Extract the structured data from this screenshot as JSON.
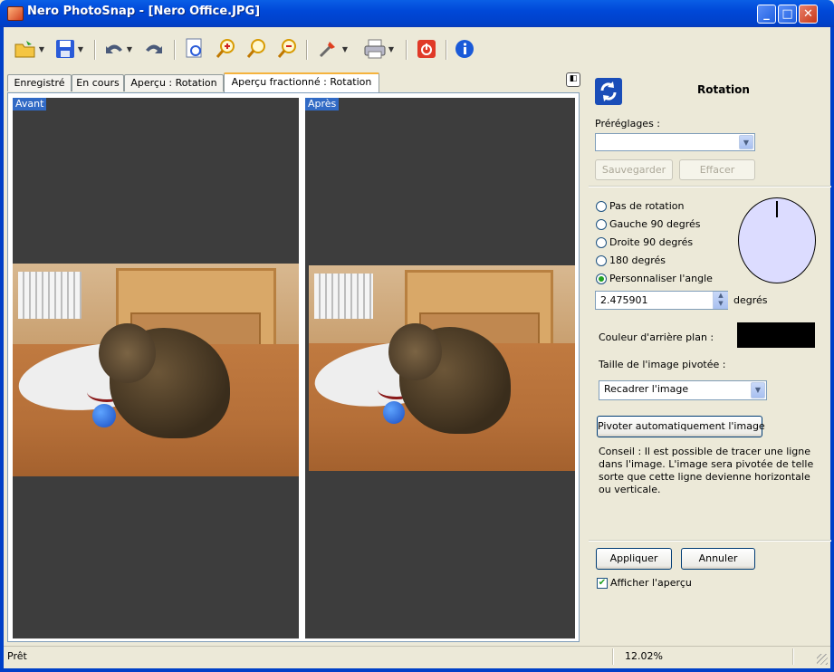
{
  "window": {
    "title": "Nero PhotoSnap - [Nero Office.JPG]",
    "minimize_glyph": "_",
    "maximize_glyph": "□",
    "close_glyph": "✕"
  },
  "toolbar": {
    "icons": [
      "open-folder-icon",
      "save-icon",
      "undo-icon",
      "redo-icon",
      "page-preview-icon",
      "zoom-in-icon",
      "zoom-fit-icon",
      "zoom-out-icon",
      "tools-icon",
      "print-icon",
      "power-icon",
      "info-icon"
    ]
  },
  "tabs": [
    {
      "label": "Enregistré",
      "active": false
    },
    {
      "label": "En cours",
      "active": false
    },
    {
      "label": "Aperçu : Rotation",
      "active": false
    },
    {
      "label": "Aperçu fractionné : Rotation",
      "active": true
    }
  ],
  "preview": {
    "before_label": "Avant",
    "after_label": "Après"
  },
  "panel": {
    "title": "Rotation",
    "presets_label": "Préréglages :",
    "presets_value": "",
    "save_label": "Sauvegarder",
    "clear_label": "Effacer",
    "rotation_options": [
      {
        "label": "Pas de rotation",
        "selected": false
      },
      {
        "label": "Gauche 90 degrés",
        "selected": false
      },
      {
        "label": "Droite 90 degrés",
        "selected": false
      },
      {
        "label": "180 degrés",
        "selected": false
      },
      {
        "label": "Personnaliser l'angle",
        "selected": true
      }
    ],
    "angle_value": "2.475901",
    "angle_unit": "degrés",
    "bgcolor_label": "Couleur d'arrière plan :",
    "bgcolor_value": "#000000",
    "size_label": "Taille de l'image pivotée :",
    "size_value": "Recadrer l'image",
    "auto_rotate_label": "Pivoter automatiquement l'image",
    "tip": "Conseil : Il est possible de tracer une ligne dans l'image. L'image sera pivotée de telle sorte que cette ligne devienne horizontale ou verticale.",
    "apply_label": "Appliquer",
    "cancel_label": "Annuler",
    "show_preview_label": "Afficher l'aperçu",
    "show_preview_checked": true
  },
  "status": {
    "text": "Prêt",
    "zoom": "12.02%"
  },
  "colors": {
    "titlebar": "#0048d8",
    "selection": "#316ac5",
    "preview_bg": "#3d3d3d",
    "dial_fill": "#dcdcff"
  }
}
